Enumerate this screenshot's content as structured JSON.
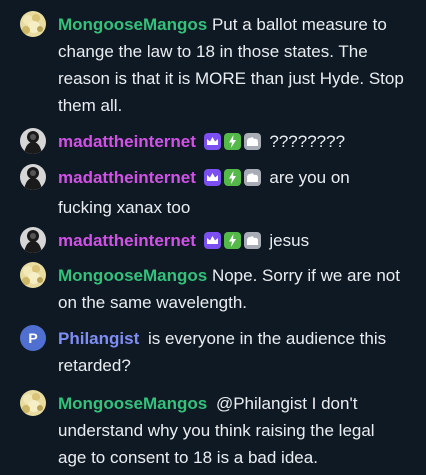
{
  "colors": {
    "background": "#0f1923",
    "mongoose_name": "#34c17b",
    "madatt_name": "#d252e8",
    "philangist_name": "#7f8ef5",
    "text": "#eaeef2"
  },
  "messages": [
    {
      "user": "MongooseMangos",
      "avatar_icon": "yellow-puppy-avatar",
      "badges": [],
      "text": "Put a ballot measure to change the law to 18 in those states. The reason is that it is MORE than just Hyde. Stop them all."
    },
    {
      "user": "madattheinternet",
      "avatar_icon": "dark-figure-avatar",
      "badges": [
        "crown-icon",
        "bolt-icon",
        "cloud-icon"
      ],
      "text": "????????"
    },
    {
      "user": "madattheinternet",
      "avatar_icon": "dark-figure-avatar",
      "badges": [
        "crown-icon",
        "bolt-icon",
        "cloud-icon"
      ],
      "text": "are you on fucking xanax too"
    },
    {
      "user": "madattheinternet",
      "avatar_icon": "dark-figure-avatar",
      "badges": [
        "crown-icon",
        "bolt-icon",
        "cloud-icon"
      ],
      "text": "jesus"
    },
    {
      "user": "MongooseMangos",
      "avatar_icon": "yellow-puppy-avatar",
      "badges": [],
      "text": "Nope. Sorry if we are not on the same wavelength."
    },
    {
      "user": "Philangist",
      "avatar_icon": "letter-avatar",
      "avatar_letter": "P",
      "badges": [],
      "text": "is everyone in the audience this retarded?"
    },
    {
      "user": "MongooseMangos",
      "avatar_icon": "yellow-puppy-avatar",
      "badges": [],
      "text": "@Philangist I don't understand why you think raising the legal age to consent to 18 is a bad idea."
    }
  ]
}
